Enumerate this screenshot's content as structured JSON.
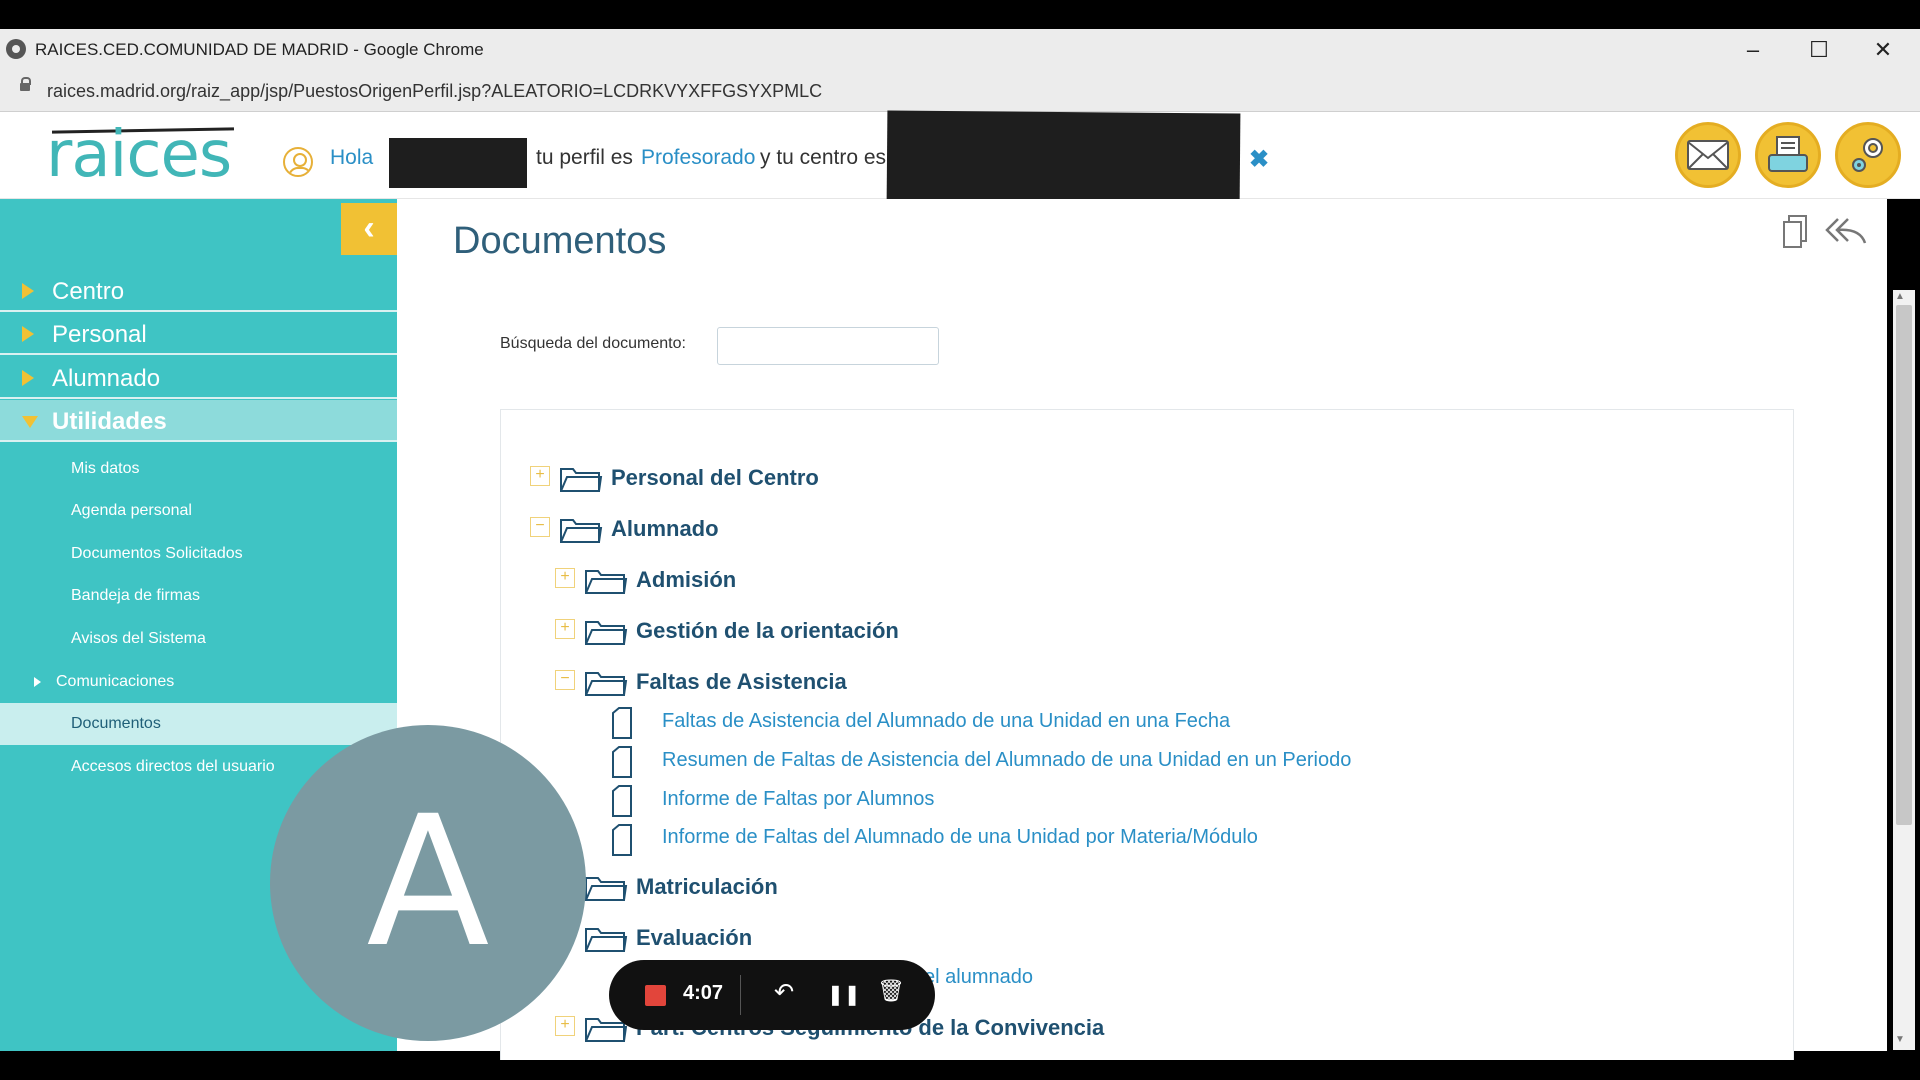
{
  "window": {
    "title": "RAICES.CED.COMUNIDAD DE MADRID - Google Chrome",
    "minimize": "–",
    "maximize": "☐",
    "close": "✕"
  },
  "address": {
    "url": "raices.madrid.org/raiz_app/jsp/PuestosOrigenPerfil.jsp?ALEATORIO=LCDRKVYXFFGSYXPMLC"
  },
  "header": {
    "logo": "raices",
    "greeting": "Hola",
    "profile_prefix": "tu perfil es",
    "profile": "Profesorado",
    "center_prefix": "y tu centro es",
    "close_glyph": "✖"
  },
  "sidebar": {
    "collapse_glyph": "‹",
    "main": [
      {
        "label": "Centro"
      },
      {
        "label": "Personal"
      },
      {
        "label": "Alumnado"
      },
      {
        "label": "Utilidades",
        "expanded": true
      }
    ],
    "sub": [
      {
        "label": "Mis datos"
      },
      {
        "label": "Agenda personal"
      },
      {
        "label": "Documentos Solicitados"
      },
      {
        "label": "Bandeja de firmas"
      },
      {
        "label": "Avisos del Sistema"
      },
      {
        "label": "Comunicaciones"
      },
      {
        "label": "Documentos",
        "active": true
      },
      {
        "label": "Accesos directos del usuario"
      }
    ]
  },
  "main": {
    "title": "Documentos",
    "search_label": "Búsqueda del documento:",
    "search_value": "",
    "tree": {
      "personal_centro": "Personal del Centro",
      "alumnado": "Alumnado",
      "admision": "Admisión",
      "orientacion": "Gestión de la orientación",
      "faltas": "Faltas de Asistencia",
      "docs": [
        "Faltas de Asistencia del Alumnado de una Unidad en una Fecha",
        "Resumen de Faltas de Asistencia del Alumnado de una Unidad en un Periodo",
        "Informe de Faltas por Alumnos",
        "Informe de Faltas del Alumnado de una Unidad por Materia/Módulo"
      ],
      "matriculacion": "Matriculación",
      "evaluacion": "Evaluación",
      "eval_doc_fragment": "el alumnado",
      "convivencia": "Part. Centros Seguimiento de la Convivencia",
      "expand_glyph": "+",
      "collapse_glyph": "−"
    }
  },
  "overlay": {
    "avatar_letter": "A",
    "recorder_time": "4:07",
    "undo_glyph": "↶",
    "pause_glyph": "❚❚",
    "trash_glyph": "🗑"
  },
  "colors": {
    "accent": "#3fc4c4",
    "yellow": "#f1c134",
    "link": "#2a8fc6",
    "heading": "#2f5f7a"
  }
}
